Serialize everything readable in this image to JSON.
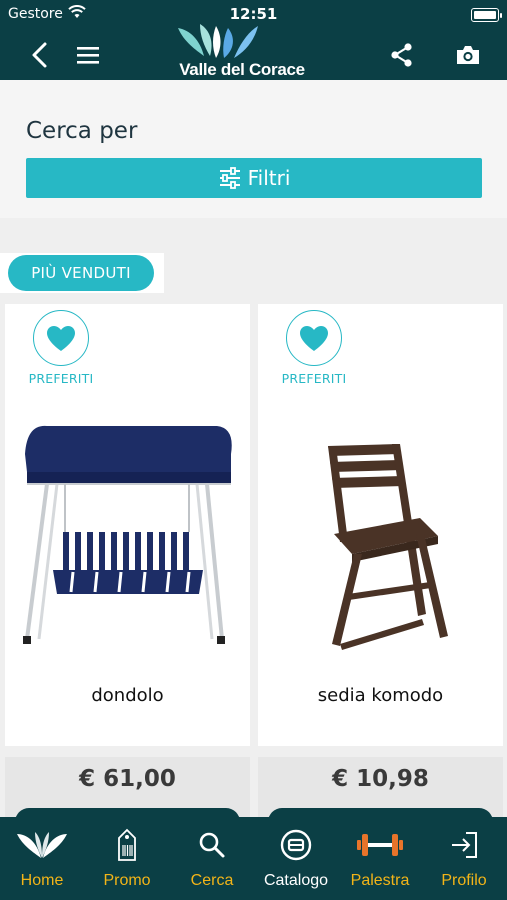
{
  "status": {
    "carrier": "Gestore",
    "time": "12:51"
  },
  "header": {
    "brand": "Valle del Corace"
  },
  "search": {
    "title": "Cerca per",
    "filter_label": "Filtri"
  },
  "section": {
    "pill_label": "PIÙ VENDUTI"
  },
  "products": [
    {
      "name": "dondolo",
      "price": "€ 61,00",
      "fav_label": "PREFERITI"
    },
    {
      "name": "sedia komodo",
      "price": "€ 10,98",
      "fav_label": "PREFERITI"
    }
  ],
  "tabs": [
    {
      "label": "Home",
      "icon": "home-logo-icon"
    },
    {
      "label": "Promo",
      "icon": "tag-icon"
    },
    {
      "label": "Cerca",
      "icon": "search-icon"
    },
    {
      "label": "Catalogo",
      "icon": "catalog-icon",
      "active": true
    },
    {
      "label": "Palestra",
      "icon": "dumbbell-icon"
    },
    {
      "label": "Profilo",
      "icon": "login-icon"
    }
  ],
  "colors": {
    "primary": "#0b3f45",
    "accent": "#27b8c5",
    "tab_text": "#f2b418"
  }
}
